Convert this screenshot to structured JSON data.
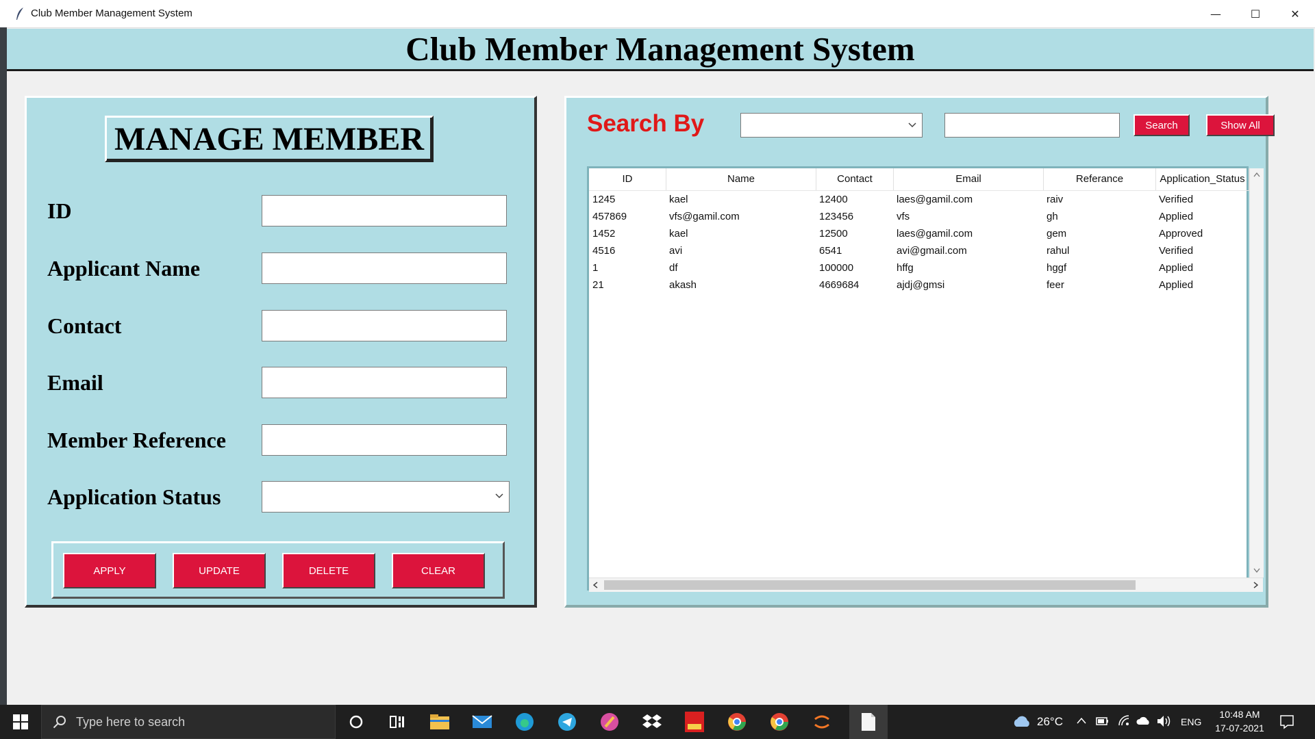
{
  "window": {
    "title": "Club Member Management System",
    "minimize_glyph": "—",
    "maximize_glyph": "☐",
    "close_glyph": "✕"
  },
  "banner": {
    "title": "Club Member Management System"
  },
  "form": {
    "heading": "MANAGE MEMBER",
    "fields": [
      {
        "label": "ID",
        "value": ""
      },
      {
        "label": "Applicant Name",
        "value": ""
      },
      {
        "label": "Contact",
        "value": ""
      },
      {
        "label": "Email",
        "value": ""
      },
      {
        "label": "Member Reference",
        "value": ""
      },
      {
        "label": "Application Status",
        "value": ""
      }
    ],
    "buttons": {
      "apply": "APPLY",
      "update": "UPDATE",
      "delete": "DELETE",
      "clear": "CLEAR"
    }
  },
  "search": {
    "label": "Search By",
    "select_value": "",
    "text_value": "",
    "search_button": "Search",
    "show_all_button": "Show All"
  },
  "table": {
    "columns": [
      "ID",
      "Name",
      "Contact",
      "Email",
      "Referance",
      "Application_Status"
    ],
    "rows": [
      [
        "1245",
        "kael",
        "12400",
        "laes@gamil.com",
        "raiv",
        "Verified"
      ],
      [
        "457869",
        "vfs@gamil.com",
        "123456",
        "vfs",
        "gh",
        "Applied"
      ],
      [
        "1452",
        "kael",
        "12500",
        "laes@gamil.com",
        "gem",
        "Approved"
      ],
      [
        "4516",
        "avi",
        "6541",
        "avi@gmail.com",
        "rahul",
        "Verified"
      ],
      [
        "1",
        "df",
        "100000",
        "hffg",
        "hggf",
        "Applied"
      ],
      [
        "21",
        "akash",
        "4669684",
        "ajdj@gmsi",
        "feer",
        "Applied"
      ]
    ]
  },
  "taskbar": {
    "search_placeholder": "Type here to search",
    "temperature": "26°C",
    "language": "ENG",
    "time": "10:48 AM",
    "date": "17-07-2021"
  },
  "colors": {
    "panel_bg": "#b0dde4",
    "button_red": "#dc143c",
    "search_label_red": "#e01818",
    "taskbar_bg": "#1f1f1f"
  }
}
